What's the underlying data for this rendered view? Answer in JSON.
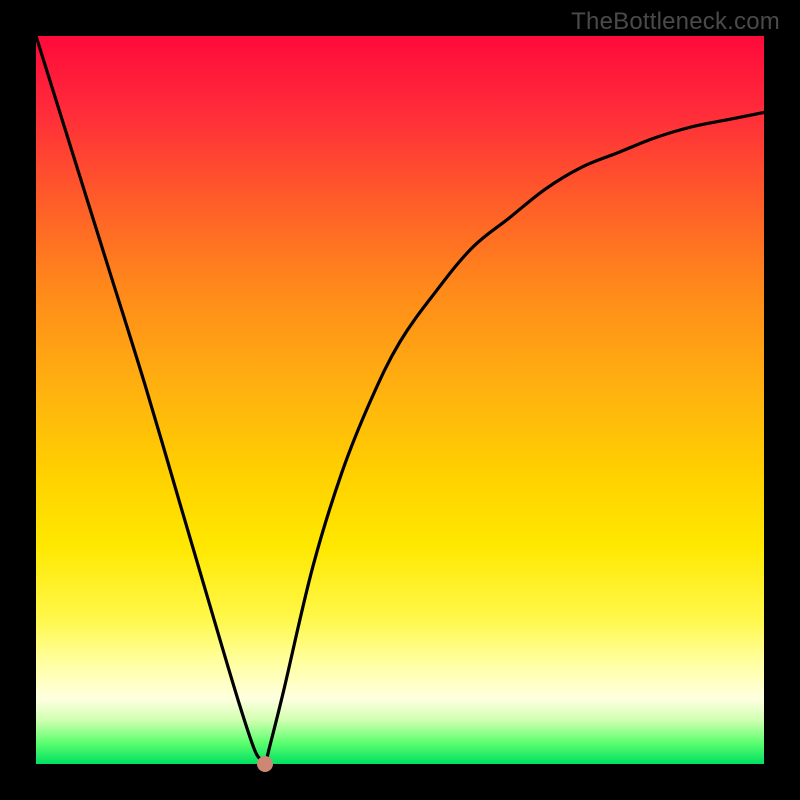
{
  "attribution": "TheBottleneck.com",
  "chart_data": {
    "type": "line",
    "title": "",
    "xlabel": "",
    "ylabel": "",
    "xlim": [
      0,
      1
    ],
    "ylim": [
      0,
      1
    ],
    "series": [
      {
        "name": "bottleneck-curve",
        "x": [
          0.0,
          0.05,
          0.1,
          0.15,
          0.2,
          0.25,
          0.28,
          0.3,
          0.31,
          0.315,
          0.32,
          0.34,
          0.38,
          0.42,
          0.46,
          0.5,
          0.55,
          0.6,
          0.65,
          0.7,
          0.75,
          0.8,
          0.85,
          0.9,
          0.95,
          1.0
        ],
        "y": [
          1.0,
          0.84,
          0.68,
          0.52,
          0.35,
          0.18,
          0.08,
          0.02,
          0.005,
          0.0,
          0.02,
          0.1,
          0.27,
          0.4,
          0.5,
          0.58,
          0.65,
          0.71,
          0.75,
          0.79,
          0.82,
          0.84,
          0.86,
          0.875,
          0.885,
          0.895
        ]
      }
    ],
    "marker": {
      "x": 0.315,
      "y": 0.0
    }
  },
  "colors": {
    "curve": "#000000",
    "marker": "#cc8874",
    "frame": "#000000"
  }
}
